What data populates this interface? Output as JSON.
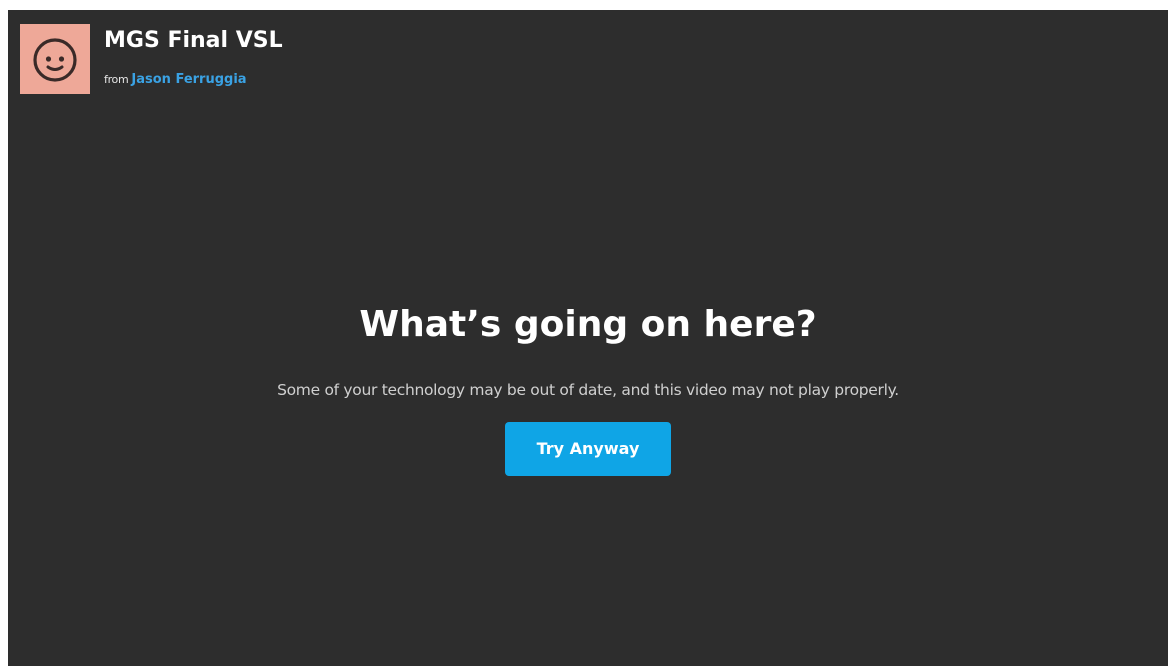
{
  "video": {
    "title": "MGS Final VSL",
    "from_label": "from",
    "author": "Jason Ferruggia",
    "avatar_icon": "smiley-face-icon"
  },
  "message": {
    "heading": "What’s going on here?",
    "body": "Some of your technology may be out of date, and this video may not play properly.",
    "button_label": "Try Anyway"
  },
  "colors": {
    "background": "#2d2d2d",
    "accent": "#0fa5e6",
    "author_link": "#3aa2e4",
    "avatar_bg": "#eea898"
  }
}
